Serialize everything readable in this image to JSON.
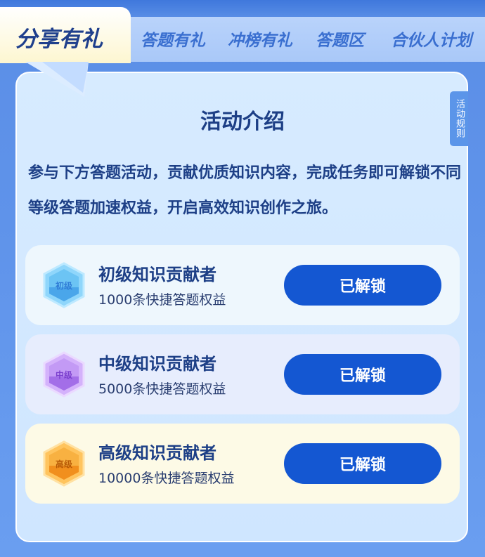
{
  "tabs": [
    {
      "label": "分享有礼",
      "active": true
    },
    {
      "label": "答题有礼"
    },
    {
      "label": "冲榜有礼"
    },
    {
      "label": "答题区"
    },
    {
      "label": "合伙人计划"
    }
  ],
  "rules_label": "活动规则",
  "section": {
    "title": "活动介绍",
    "intro": "参与下方答题活动，贡献优质知识内容，完成任务即可解锁不同等级答题加速权益，开启高效知识创作之旅。"
  },
  "tiers": [
    {
      "badge": "初级",
      "name": "初级知识贡献者",
      "benefit": "1000条快捷答题权益",
      "button": "已解锁",
      "color": "#6cc4f4"
    },
    {
      "badge": "中级",
      "name": "中级知识贡献者",
      "benefit": "5000条快捷答题权益",
      "button": "已解锁",
      "color": "#b37ef0"
    },
    {
      "badge": "高级",
      "name": "高级知识贡献者",
      "benefit": "10000条快捷答题权益",
      "button": "已解锁",
      "color": "#f6a235"
    }
  ],
  "colors": {
    "accent": "#1457d2",
    "title_text": "#1d3f86"
  }
}
